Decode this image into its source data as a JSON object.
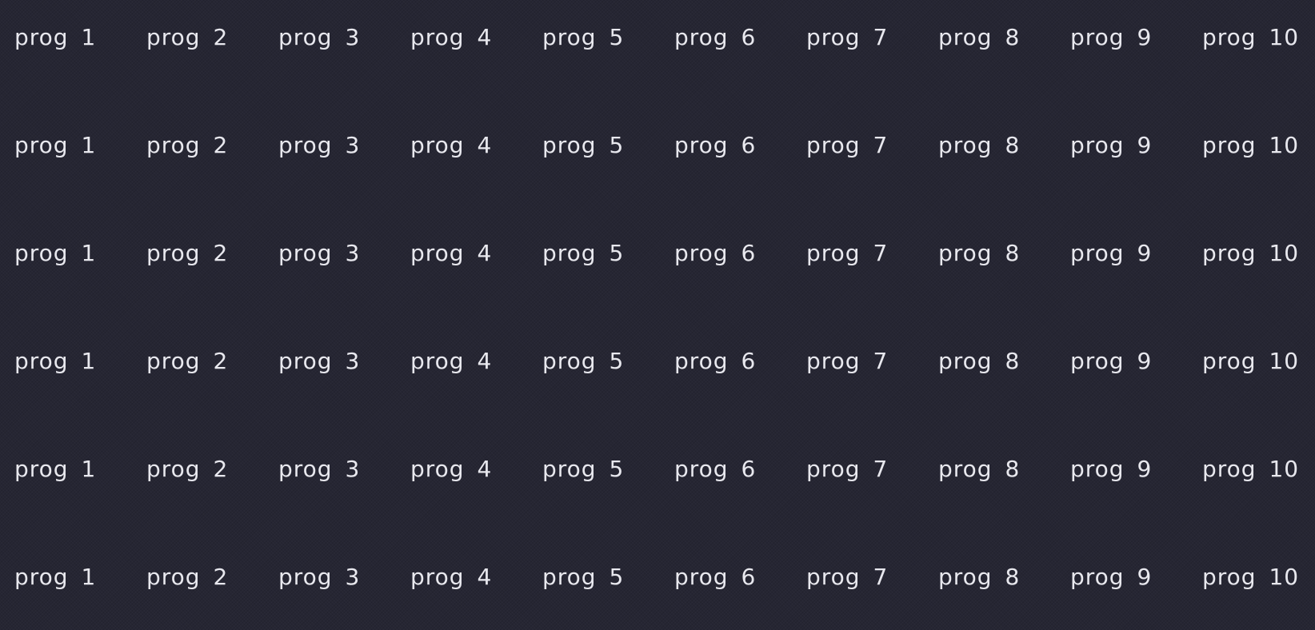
{
  "buttons": [
    [
      "prog 1",
      "prog 2",
      "prog 3",
      "prog 4",
      "prog 5",
      "prog 6",
      "prog 7",
      "prog 8",
      "prog 9",
      "prog 10"
    ],
    [
      "prog 1",
      "prog 2",
      "prog 3",
      "prog 4",
      "prog 5",
      "prog 6",
      "prog 7",
      "prog 8",
      "prog 9",
      "prog 10"
    ],
    [
      "prog 1",
      "prog 2",
      "prog 3",
      "prog 4",
      "prog 5",
      "prog 6",
      "prog 7",
      "prog 8",
      "prog 9",
      "prog 10"
    ],
    [
      "prog 1",
      "prog 2",
      "prog 3",
      "prog 4",
      "prog 5",
      "prog 6",
      "prog 7",
      "prog 8",
      "prog 9",
      "prog 10"
    ],
    [
      "prog 1",
      "prog 2",
      "prog 3",
      "prog 4",
      "prog 5",
      "prog 6",
      "prog 7",
      "prog 8",
      "prog 9",
      "prog 10"
    ],
    [
      "prog 1",
      "prog 2",
      "prog 3",
      "prog 4",
      "prog 5",
      "prog 6",
      "prog 7",
      "prog 8",
      "prog 9",
      "prog 10"
    ]
  ],
  "colors": {
    "background": "#262633",
    "text": "#e8e8ee"
  }
}
